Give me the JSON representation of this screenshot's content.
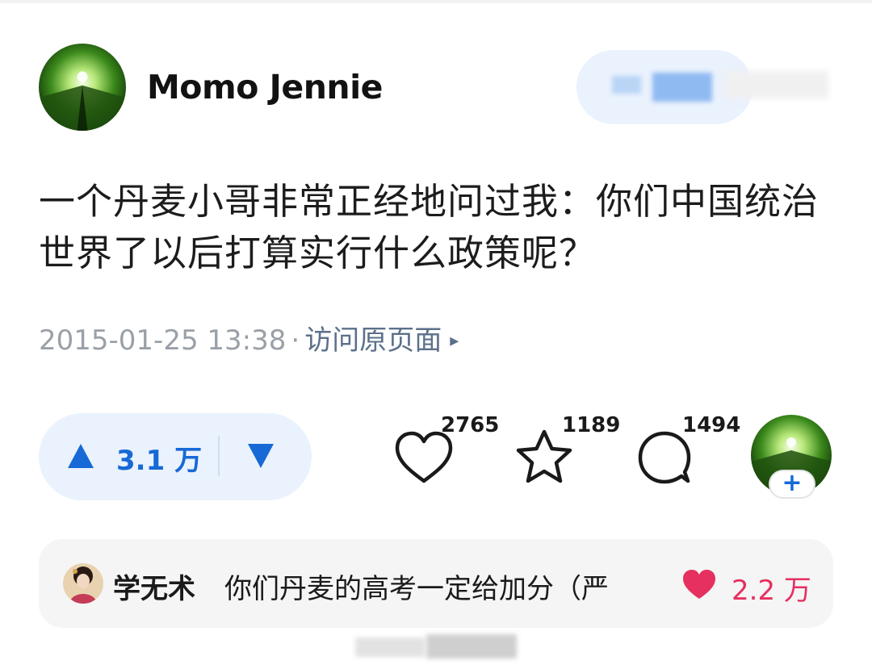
{
  "author": {
    "name": "Momo Jennie"
  },
  "post": {
    "text": "一个丹麦小哥非常正经地问过我：你们中国统治世界了以后打算实行什么政策呢？",
    "timestamp": "2015-01-25 13:38",
    "separator": "·",
    "visit_link": "访问原页面",
    "visit_arrow": "▸"
  },
  "vote": {
    "count": "3.1 万"
  },
  "actions": {
    "likes": "2765",
    "favorites": "1189",
    "comments": "1494"
  },
  "follow_badge": "+",
  "hot_comment": {
    "user": "学无术",
    "text": "你们丹麦的高考一定给加分（严",
    "likes": "2.2 万"
  },
  "colors": {
    "accent_blue": "#1769d6",
    "pill_bg": "#eaf2fd",
    "like_red": "#e53060",
    "meta_gray": "#9aa0a8"
  },
  "icons": {
    "upvote": "triangle-up-icon",
    "downvote": "triangle-down-icon",
    "like": "heart-outline-icon",
    "favorite": "star-outline-icon",
    "comment": "speech-bubble-icon",
    "comment_like": "heart-filled-icon"
  }
}
